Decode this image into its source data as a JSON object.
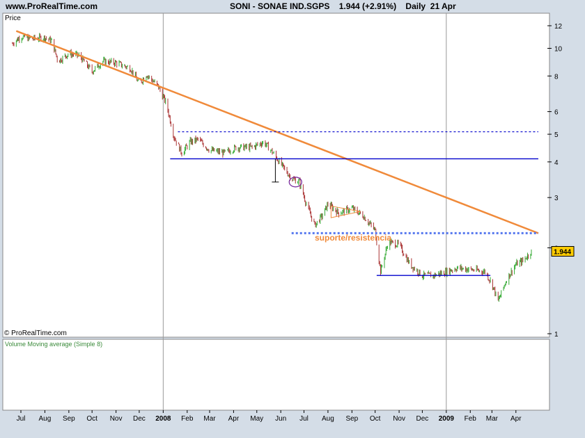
{
  "header": {
    "site": "www.ProRealTime.com",
    "title": "SONI - SONAE IND.SGPS    1.944 (+2.91%)    Daily  21 Apr"
  },
  "price_panel": {
    "label": "Price",
    "copyright": "© ProRealTime.com"
  },
  "volume_panel": {
    "label": "Volume Moving average (Simple 8)"
  },
  "annotation": {
    "text": "suporte/resistencia"
  },
  "colors": {
    "background": "#d4dde7",
    "panel": "#ffffff",
    "trend": "#f08a3a",
    "support": "#0000cc",
    "dotted": "#5577ee",
    "candle_up": "#33aa33",
    "candle_down": "#aa3333"
  },
  "chart_data": {
    "type": "line",
    "y_scale": "log",
    "ylim": [
      1,
      13
    ],
    "y_ticks": [
      1,
      2,
      3,
      4,
      5,
      6,
      8,
      10,
      12
    ],
    "x_ticks": [
      "Jul",
      "Aug",
      "Sep",
      "Oct",
      "Nov",
      "Dec",
      "2008",
      "Feb",
      "Mar",
      "Apr",
      "May",
      "Jun",
      "Jul",
      "Aug",
      "Sep",
      "Oct",
      "Nov",
      "Dec",
      "2009",
      "Feb",
      "Mar",
      "Apr"
    ],
    "last_price": {
      "value": 1.944,
      "label": "1.944"
    },
    "series": [
      {
        "values": [
          {
            "x": "2007-06-20",
            "y": 10.4
          },
          {
            "x": "2007-07-01",
            "y": 11.0
          },
          {
            "x": "2007-07-15",
            "y": 10.8
          },
          {
            "x": "2007-08-01",
            "y": 10.9
          },
          {
            "x": "2007-08-10",
            "y": 10.6
          },
          {
            "x": "2007-08-18",
            "y": 9.0
          },
          {
            "x": "2007-09-01",
            "y": 9.6
          },
          {
            "x": "2007-09-15",
            "y": 9.4
          },
          {
            "x": "2007-10-01",
            "y": 8.3
          },
          {
            "x": "2007-10-15",
            "y": 9.0
          },
          {
            "x": "2007-11-01",
            "y": 8.9
          },
          {
            "x": "2007-11-20",
            "y": 8.5
          },
          {
            "x": "2007-12-01",
            "y": 7.5
          },
          {
            "x": "2007-12-10",
            "y": 8.1
          },
          {
            "x": "2007-12-25",
            "y": 7.4
          },
          {
            "x": "2008-01-05",
            "y": 6.4
          },
          {
            "x": "2008-01-15",
            "y": 4.9
          },
          {
            "x": "2008-01-25",
            "y": 4.3
          },
          {
            "x": "2008-02-05",
            "y": 4.7
          },
          {
            "x": "2008-02-15",
            "y": 4.8
          },
          {
            "x": "2008-03-01",
            "y": 4.4
          },
          {
            "x": "2008-03-20",
            "y": 4.3
          },
          {
            "x": "2008-04-05",
            "y": 4.5
          },
          {
            "x": "2008-04-25",
            "y": 4.5
          },
          {
            "x": "2008-05-10",
            "y": 4.7
          },
          {
            "x": "2008-05-22",
            "y": 4.3
          },
          {
            "x": "2008-06-05",
            "y": 3.8
          },
          {
            "x": "2008-06-15",
            "y": 3.5
          },
          {
            "x": "2008-06-25",
            "y": 3.4
          },
          {
            "x": "2008-07-05",
            "y": 2.8
          },
          {
            "x": "2008-07-15",
            "y": 2.4
          },
          {
            "x": "2008-07-25",
            "y": 2.6
          },
          {
            "x": "2008-08-01",
            "y": 2.85
          },
          {
            "x": "2008-08-15",
            "y": 2.65
          },
          {
            "x": "2008-09-01",
            "y": 2.75
          },
          {
            "x": "2008-09-15",
            "y": 2.6
          },
          {
            "x": "2008-10-01",
            "y": 2.3
          },
          {
            "x": "2008-10-08",
            "y": 1.65
          },
          {
            "x": "2008-10-18",
            "y": 2.1
          },
          {
            "x": "2008-11-01",
            "y": 2.05
          },
          {
            "x": "2008-11-15",
            "y": 1.75
          },
          {
            "x": "2008-12-01",
            "y": 1.6
          },
          {
            "x": "2008-12-15",
            "y": 1.6
          },
          {
            "x": "2009-01-01",
            "y": 1.65
          },
          {
            "x": "2009-01-15",
            "y": 1.7
          },
          {
            "x": "2009-02-01",
            "y": 1.68
          },
          {
            "x": "2009-02-20",
            "y": 1.65
          },
          {
            "x": "2009-03-01",
            "y": 1.5
          },
          {
            "x": "2009-03-09",
            "y": 1.3
          },
          {
            "x": "2009-03-20",
            "y": 1.55
          },
          {
            "x": "2009-04-01",
            "y": 1.75
          },
          {
            "x": "2009-04-10",
            "y": 1.8
          },
          {
            "x": "2009-04-21",
            "y": 1.944
          }
        ]
      }
    ],
    "annotations": [
      {
        "kind": "trendline",
        "from": {
          "x": "2007-06-25",
          "y": 11.5
        },
        "to": {
          "x": "2009-04-30",
          "y": 2.25
        }
      },
      {
        "kind": "resistance",
        "style": "dashed",
        "y": 5.1,
        "from": "2008-01-20",
        "to": "2009-04-30"
      },
      {
        "kind": "support",
        "y": 4.1,
        "from": "2008-01-10",
        "to": "2009-04-30"
      },
      {
        "kind": "support",
        "style": "dotted",
        "y": 2.25,
        "from": "2008-06-15",
        "to": "2009-04-30",
        "label": "suporte/resistencia"
      },
      {
        "kind": "support",
        "y": 1.6,
        "from": "2008-10-03",
        "to": "2009-02-27"
      }
    ],
    "grid": false,
    "volume_panel": {
      "title": "Volume Moving average (Simple 8)"
    }
  }
}
